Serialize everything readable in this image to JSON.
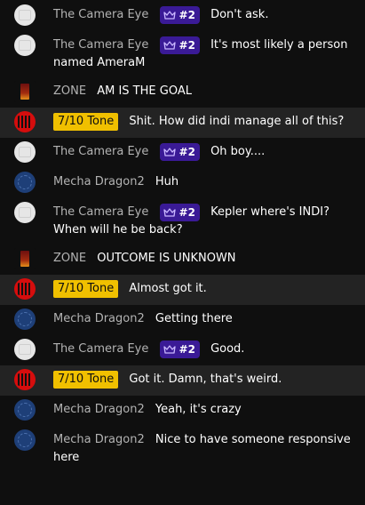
{
  "colors": {
    "background": "#0f0f0f",
    "highlight_row": "#232323",
    "author_name": "#b3b3b3",
    "tone_badge": "#f0c000",
    "rank_badge": "#3a1a96"
  },
  "messages": [
    {
      "author": "The Camera Eye",
      "avatar": "white",
      "badge_type": "rank",
      "badge": "#2",
      "text": "Don't ask.",
      "highlight": false
    },
    {
      "author": "The Camera Eye",
      "avatar": "white",
      "badge_type": "rank",
      "badge": "#2",
      "text": "It's most likely a person named AmeraM",
      "highlight": false
    },
    {
      "author": "ZONE",
      "avatar": "zone",
      "badge_type": "none",
      "badge": "",
      "text": "AM IS THE GOAL",
      "highlight": false
    },
    {
      "author": "",
      "avatar": "tone",
      "badge_type": "tone",
      "badge": "7/10 Tone",
      "text": "Shit. How did indi manage all of this?",
      "highlight": true
    },
    {
      "author": "The Camera Eye",
      "avatar": "white",
      "badge_type": "rank",
      "badge": "#2",
      "text": "Oh boy....",
      "highlight": false
    },
    {
      "author": "Mecha Dragon2",
      "avatar": "blue",
      "badge_type": "none",
      "badge": "",
      "text": "Huh",
      "highlight": false
    },
    {
      "author": "The Camera Eye",
      "avatar": "white",
      "badge_type": "rank",
      "badge": "#2",
      "text": "Kepler where's INDI? When will he be back?",
      "highlight": false
    },
    {
      "author": "ZONE",
      "avatar": "zone",
      "badge_type": "none",
      "badge": "",
      "text": "OUTCOME IS UNKNOWN",
      "highlight": false
    },
    {
      "author": "",
      "avatar": "tone",
      "badge_type": "tone",
      "badge": "7/10 Tone",
      "text": "Almost got it.",
      "highlight": true
    },
    {
      "author": "Mecha Dragon2",
      "avatar": "blue",
      "badge_type": "none",
      "badge": "",
      "text": "Getting there",
      "highlight": false
    },
    {
      "author": "The Camera Eye",
      "avatar": "white",
      "badge_type": "rank",
      "badge": "#2",
      "text": "Good.",
      "highlight": false
    },
    {
      "author": "",
      "avatar": "tone",
      "badge_type": "tone",
      "badge": "7/10 Tone",
      "text": "Got it. Damn, that's weird.",
      "highlight": true
    },
    {
      "author": "Mecha Dragon2",
      "avatar": "blue",
      "badge_type": "none",
      "badge": "",
      "text": "Yeah, it's crazy",
      "highlight": false
    },
    {
      "author": "Mecha Dragon2",
      "avatar": "blue",
      "badge_type": "none",
      "badge": "",
      "text": "Nice to have someone responsive here",
      "highlight": false
    }
  ]
}
